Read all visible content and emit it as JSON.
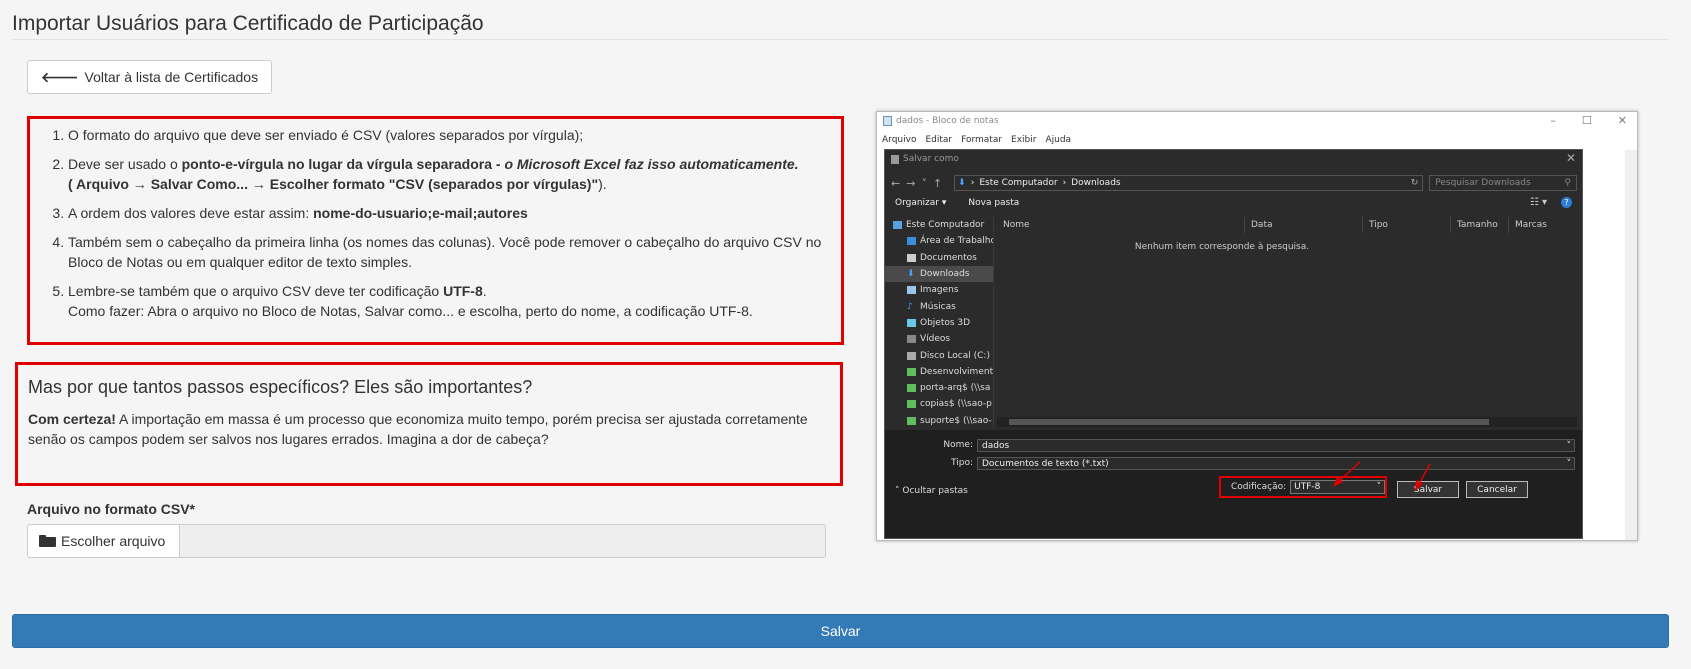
{
  "page": {
    "title": "Importar Usuários para Certificado de Participação",
    "back_button": "Voltar à lista de Certificados"
  },
  "instructions": {
    "item1": "O formato do arquivo que deve ser enviado é CSV (valores separados por vírgula);",
    "item2_a": "Deve ser usado o ",
    "item2_b": "ponto-e-vírgula no lugar da vírgula separadora - ",
    "item2_c": "o Microsoft Excel faz isso automaticamente.",
    "item2_d": "( Arquivo → Salvar Como... → Escolher formato \"CSV (separados por vírgulas)\"",
    "item2_e": ").",
    "item3_a": "A ordem dos valores deve estar assim: ",
    "item3_b": "nome-do-usuario;e-mail;autores",
    "item4": "Também sem o cabeçalho da primeira linha (os nomes das colunas). Você pode remover o cabeçalho do arquivo CSV no Bloco de Notas ou em qualquer editor de texto simples.",
    "item5_a": "Lembre-se também que o arquivo CSV deve ter codificação ",
    "item5_b": "UTF-8",
    "item5_c": ".",
    "item5_d": "Como fazer: Abra o arquivo no Bloco de Notas, Salvar como... e escolha, perto do nome, a codificação UTF-8."
  },
  "why": {
    "heading": "Mas por que tantos passos específicos? Eles são importantes?",
    "bold": "Com certeza!",
    "text": " A importação em massa é um processo que economiza muito tempo, porém precisa ser ajustada corretamente senão os campos podem ser salvos nos lugares errados. Imagina a dor de cabeça?"
  },
  "upload": {
    "label": "Arquivo no formato CSV*",
    "choose_button": "Escolher arquivo"
  },
  "save_button": "Salvar",
  "screenshot": {
    "notepad_title": "dados - Bloco de notas",
    "notepad_menu": [
      "Arquivo",
      "Editar",
      "Formatar",
      "Exibir",
      "Ajuda"
    ],
    "dialog_title": "Salvar como",
    "path_root": "Este Computador",
    "path_folder": "Downloads",
    "search_placeholder": "Pesquisar Downloads",
    "organize": "Organizar ▾",
    "new_folder": "Nova pasta",
    "tree": [
      "Este Computador",
      "Área de Trabalho",
      "Documentos",
      "Downloads",
      "Imagens",
      "Músicas",
      "Objetos 3D",
      "Vídeos",
      "Disco Local (C:)",
      "Desenvolviment",
      "porta-arq$ (\\\\sa",
      "copias$ (\\\\sao-p",
      "suporte$ (\\\\sao-"
    ],
    "columns": [
      "Nome",
      "Data",
      "Tipo",
      "Tamanho",
      "Marcas"
    ],
    "empty_message": "Nenhum item corresponde à pesquisa.",
    "name_label": "Nome:",
    "name_value": "dados",
    "type_label": "Tipo:",
    "type_value": "Documentos de texto (*.txt)",
    "hide_folders": "Ocultar pastas",
    "encoding_label": "Codificação:",
    "encoding_value": "UTF-8",
    "save": "Salvar",
    "cancel": "Cancelar"
  }
}
